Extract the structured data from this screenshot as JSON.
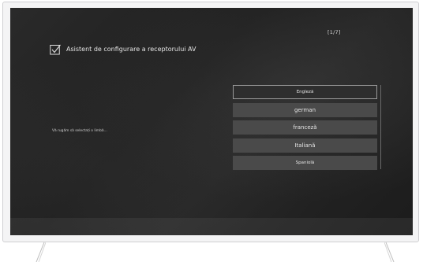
{
  "wizard": {
    "step_counter": "[1/7]",
    "title": "Asistent de configurare a receptorului AV",
    "prompt": "Vă rugăm să selectați o limbă..."
  },
  "languages": [
    {
      "label": "Engleză",
      "selected": true
    },
    {
      "label": "german",
      "selected": false
    },
    {
      "label": "franceză",
      "selected": false
    },
    {
      "label": "Italiană",
      "selected": false
    },
    {
      "label": "Spaniolă",
      "selected": false
    }
  ],
  "icons": {
    "checkbox": "checkbox-checked-icon"
  },
  "colors": {
    "screen_background": "#222222",
    "item_background": "#4a4a4a",
    "text": "#e6e6e6"
  }
}
